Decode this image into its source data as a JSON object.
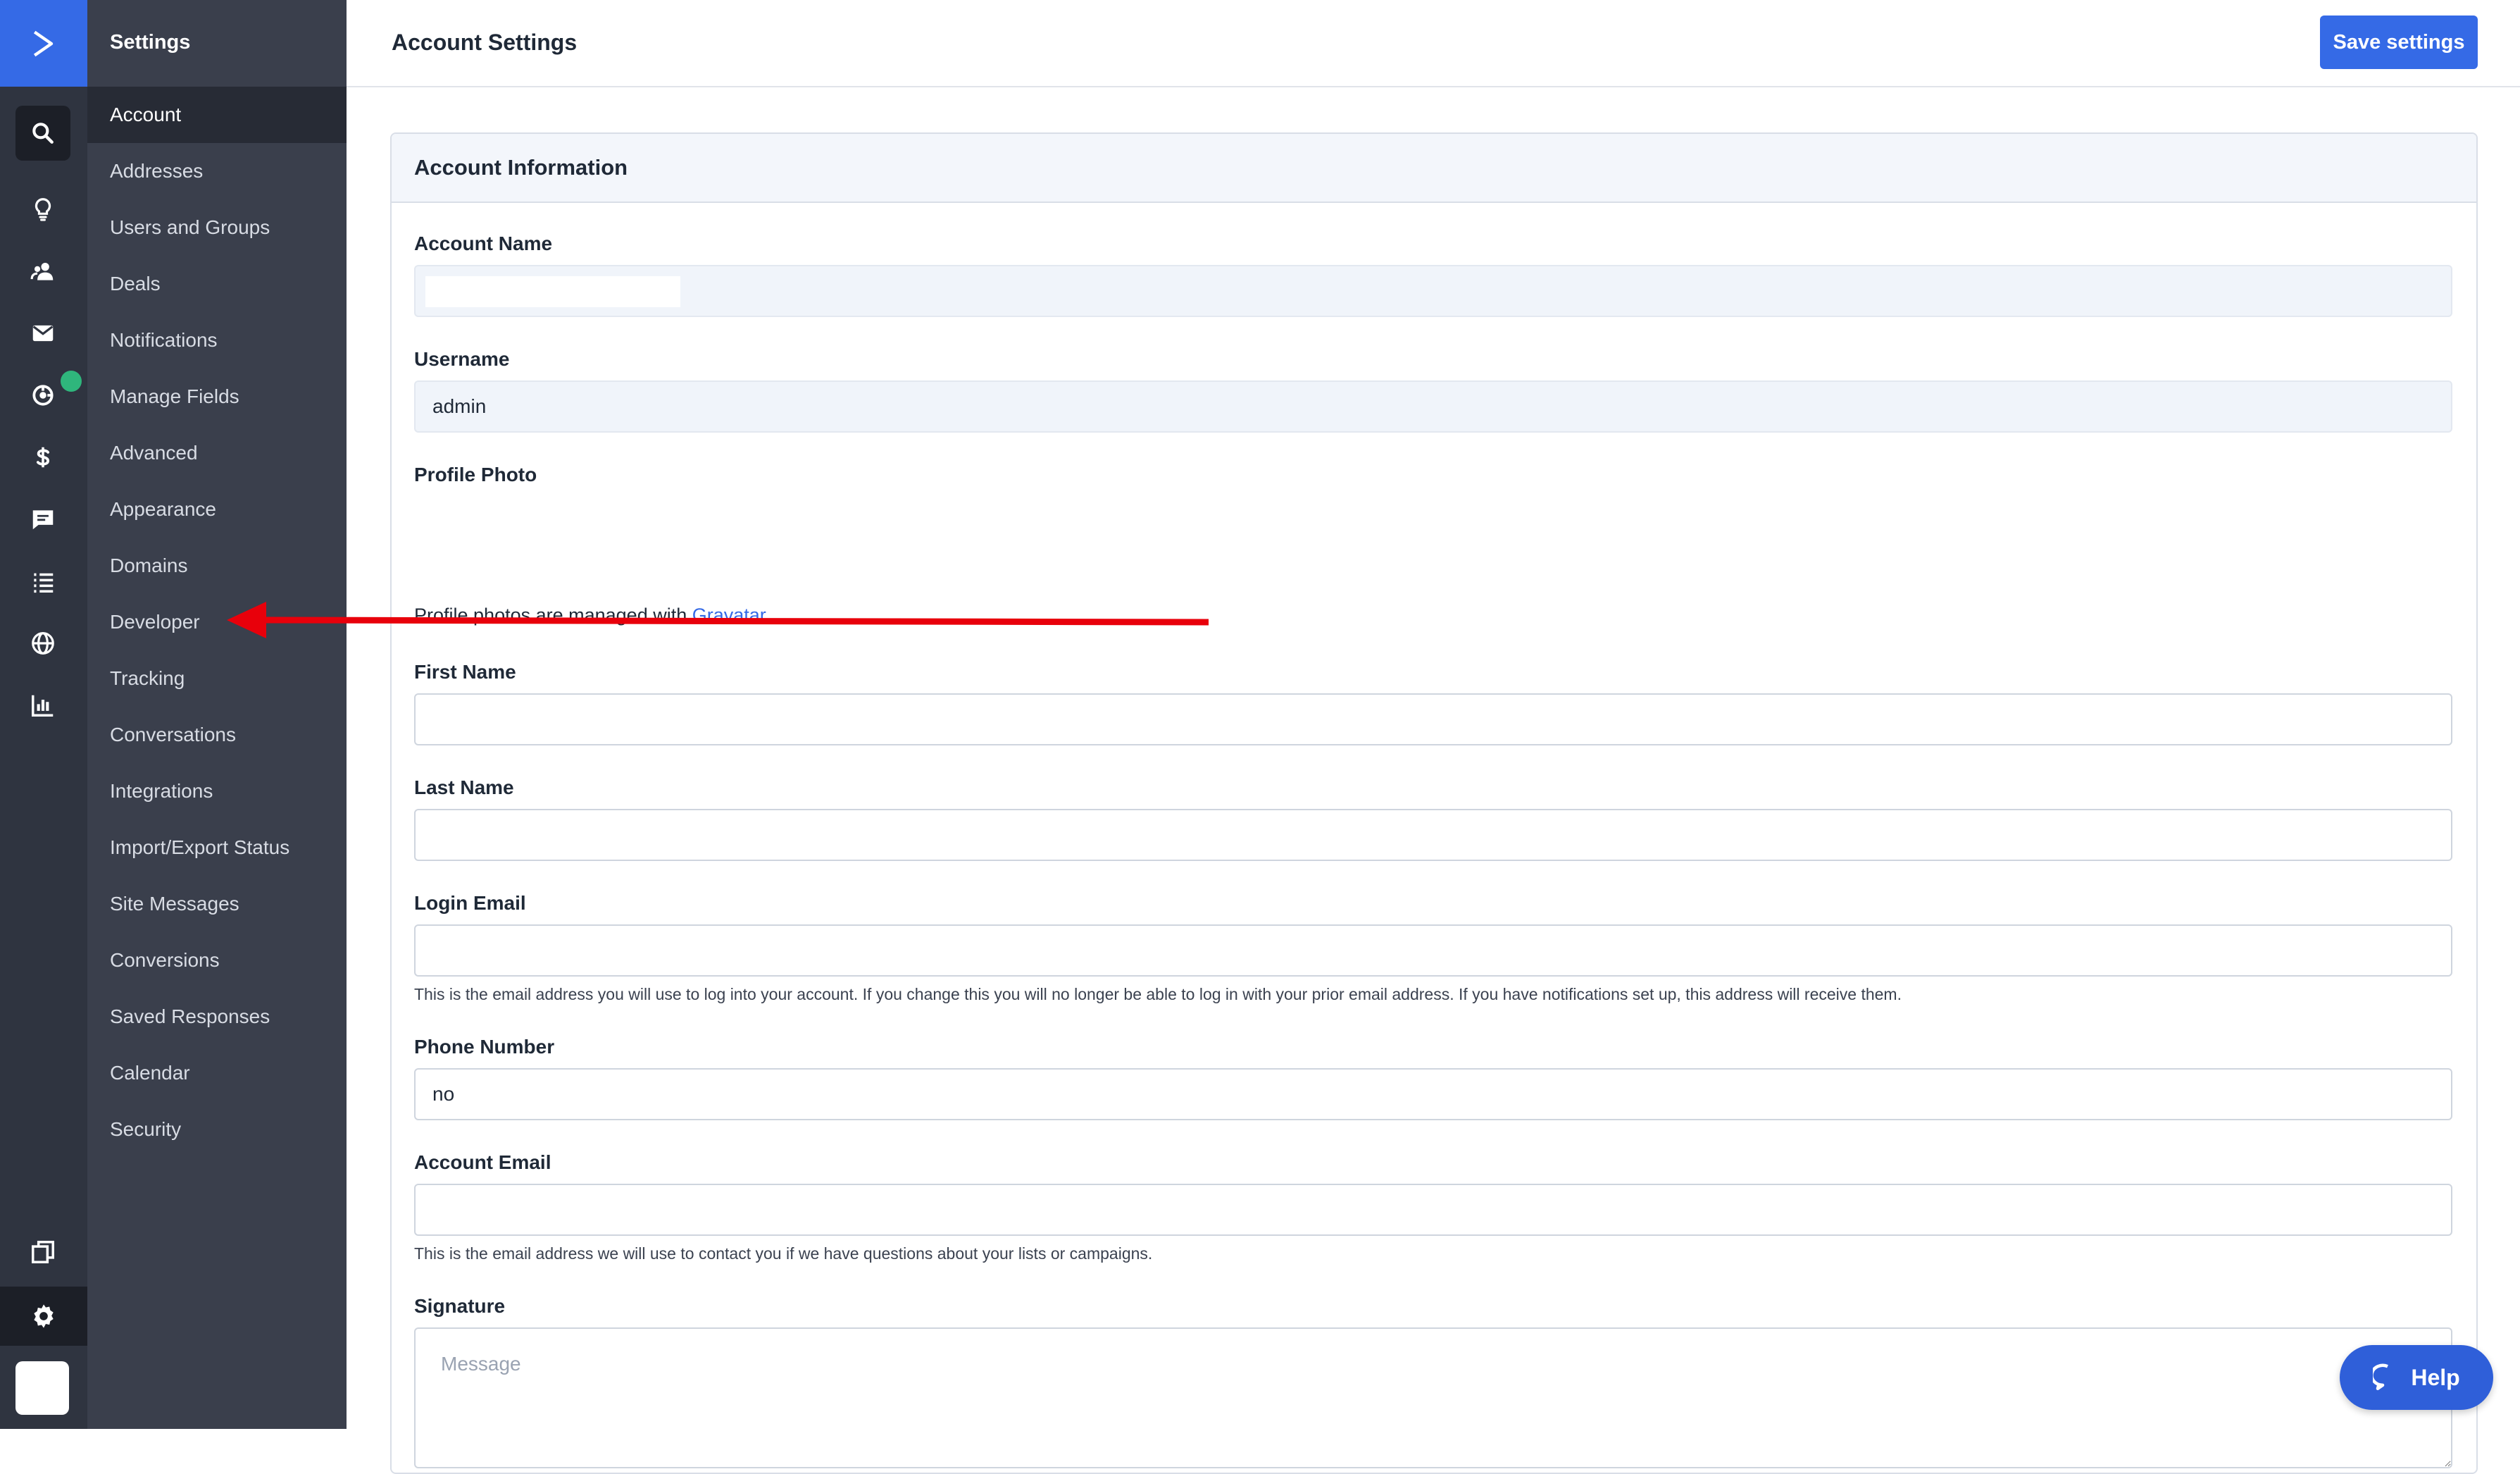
{
  "sidebar": {
    "title": "Settings",
    "items": [
      {
        "label": "Account",
        "active": true
      },
      {
        "label": "Addresses"
      },
      {
        "label": "Users and Groups"
      },
      {
        "label": "Deals"
      },
      {
        "label": "Notifications"
      },
      {
        "label": "Manage Fields"
      },
      {
        "label": "Advanced"
      },
      {
        "label": "Appearance"
      },
      {
        "label": "Domains"
      },
      {
        "label": "Developer"
      },
      {
        "label": "Tracking"
      },
      {
        "label": "Conversations"
      },
      {
        "label": "Integrations"
      },
      {
        "label": "Import/Export Status"
      },
      {
        "label": "Site Messages"
      },
      {
        "label": "Conversions"
      },
      {
        "label": "Saved Responses"
      },
      {
        "label": "Calendar"
      },
      {
        "label": "Security"
      }
    ]
  },
  "rail": {
    "icons": [
      "logo-chevron-icon",
      "search-icon",
      "lightbulb-icon",
      "contacts-icon",
      "envelope-icon",
      "automation-icon",
      "dollar-icon",
      "chat-icon",
      "list-icon",
      "globe-icon",
      "bar-chart-icon",
      "copy-icon",
      "gear-icon"
    ]
  },
  "header": {
    "title": "Account Settings",
    "save_label": "Save settings"
  },
  "card": {
    "title": "Account Information"
  },
  "form": {
    "account_name_label": "Account Name",
    "account_name_value": "",
    "username_label": "Username",
    "username_value": "admin",
    "profile_photo_label": "Profile Photo",
    "profile_photo_help": "Profile photos are managed with ",
    "gravatar_link": "Gravatar",
    "first_name_label": "First Name",
    "first_name_value": "",
    "last_name_label": "Last Name",
    "last_name_value": "",
    "login_email_label": "Login Email",
    "login_email_value": "",
    "login_email_help": "This is the email address you will use to log into your account. If you change this you will no longer be able to log in with your prior email address. If you have notifications set up, this address will receive them.",
    "phone_label": "Phone Number",
    "phone_value": "no",
    "account_email_label": "Account Email",
    "account_email_value": "",
    "account_email_help": "This is the email address we will use to contact you if we have questions about your lists or campaigns.",
    "signature_label": "Signature",
    "signature_placeholder": "Message"
  },
  "help_button": {
    "label": "Help"
  },
  "colors": {
    "brand_blue": "#356ae6",
    "rail_bg": "#2f3440",
    "sidebar_bg": "#3a3f4c",
    "annotation_red": "#e8000b",
    "status_green": "#2fb67c"
  }
}
